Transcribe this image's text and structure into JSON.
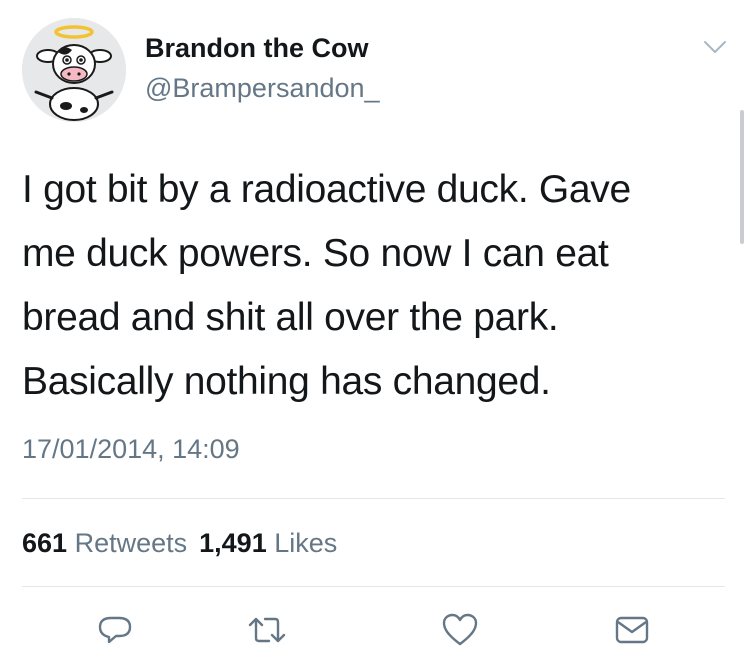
{
  "tweet": {
    "author": {
      "display_name": "Brandon the Cow",
      "handle": "@Brampersandon_"
    },
    "text_lines": [
      "I got bit by a radioactive duck. Gave",
      "me duck powers. So now I can eat",
      "bread and shit all over the park.",
      "Basically nothing has changed."
    ],
    "timestamp": "17/01/2014, 14:09",
    "stats": {
      "retweets_count": "661",
      "retweets_label": "Retweets",
      "likes_count": "1,491",
      "likes_label": "Likes"
    }
  },
  "icons": {
    "menu": "chevron-down-icon",
    "reply": "reply-icon",
    "retweet": "retweet-icon",
    "like": "heart-icon",
    "direct_message": "envelope-icon"
  },
  "colors": {
    "text_primary": "#14171a",
    "text_secondary": "#657786",
    "divider": "#e1e8ed",
    "icon": "#657786"
  }
}
